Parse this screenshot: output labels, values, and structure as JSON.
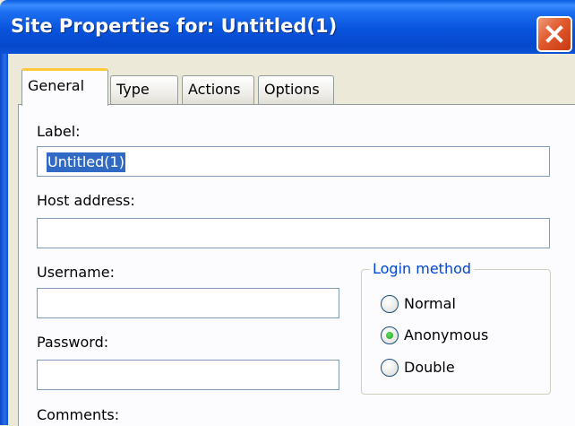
{
  "window": {
    "title": "Site Properties for: Untitled(1)",
    "close_icon": "close-icon"
  },
  "tabs": [
    {
      "label": "General",
      "active": true
    },
    {
      "label": "Type",
      "active": false
    },
    {
      "label": "Actions",
      "active": false
    },
    {
      "label": "Options",
      "active": false
    }
  ],
  "form": {
    "label_label": "Label:",
    "label_value": "Untitled(1)",
    "host_label": "Host address:",
    "host_value": "",
    "username_label": "Username:",
    "username_value": "",
    "password_label": "Password:",
    "password_value": "",
    "comments_label": "Comments:"
  },
  "login_method": {
    "title": "Login method",
    "options": [
      {
        "label": "Normal",
        "selected": false
      },
      {
        "label": "Anonymous",
        "selected": true
      },
      {
        "label": "Double",
        "selected": false
      }
    ]
  },
  "colors": {
    "titlebar": "#0853dc",
    "dialog_bg": "#ece9d8",
    "panel_bg": "#fcfcfe",
    "selection": "#316ac5",
    "group_title": "#0046d5",
    "close_button": "#e05a2d",
    "active_tab_accent": "#ffc83c"
  }
}
